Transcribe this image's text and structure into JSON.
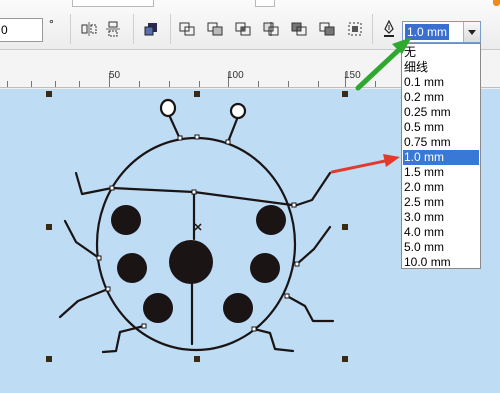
{
  "toolbar": {
    "position_value": "0",
    "degree_symbol": "°",
    "outline_width_value": "1.0 mm",
    "icons": [
      "mirror-horizontal-icon",
      "mirror-vertical-icon",
      "to-front-icon",
      "weld-icon",
      "trim-icon",
      "intersect-icon",
      "simplify-icon",
      "front-minus-back-icon",
      "back-minus-front-icon",
      "outline-pen-icon"
    ]
  },
  "ruler": {
    "ticks": [
      "50",
      "100",
      "150"
    ]
  },
  "outline_dropdown": {
    "items": [
      "无",
      "细线",
      "0.1 mm",
      "0.2 mm",
      "0.25 mm",
      "0.5 mm",
      "0.75 mm",
      "1.0 mm",
      "1.5 mm",
      "2.0 mm",
      "2.5 mm",
      "3.0 mm",
      "4.0 mm",
      "5.0 mm",
      "10.0 mm"
    ],
    "selected_index": 7
  },
  "colors": {
    "canvas": "#bfdcf5",
    "selection": "#3a78d6",
    "green_arrow": "#2ea82e",
    "red_arrow": "#e23b2e",
    "ink": "#1a1414"
  }
}
